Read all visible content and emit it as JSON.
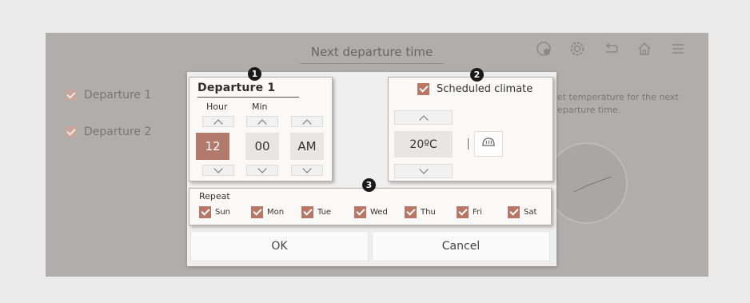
{
  "background": {
    "title": "Next departure time",
    "items": [
      {
        "label": "Departure 1",
        "checked": true
      },
      {
        "label": "Departure 2",
        "checked": true
      }
    ],
    "description": "Set temperature for the next departure time.",
    "icons": [
      "profile-icon",
      "gear-icon",
      "back-icon",
      "home-icon",
      "menu-icon"
    ]
  },
  "dialog": {
    "departure": {
      "title": "Departure 1",
      "hour_label": "Hour",
      "min_label": "Min",
      "hour": "12",
      "min": "00",
      "ampm": "AM"
    },
    "climate": {
      "scheduled_label": "Scheduled climate",
      "scheduled_checked": true,
      "temperature": "20ºC",
      "defrost_icon": "front-defrost-icon"
    },
    "repeat": {
      "label": "Repeat",
      "days": [
        {
          "label": "Sun",
          "checked": true
        },
        {
          "label": "Mon",
          "checked": true
        },
        {
          "label": "Tue",
          "checked": true
        },
        {
          "label": "Wed",
          "checked": true
        },
        {
          "label": "Thu",
          "checked": true
        },
        {
          "label": "Fri",
          "checked": true
        },
        {
          "label": "Sat",
          "checked": true
        }
      ]
    },
    "ok_label": "OK",
    "cancel_label": "Cancel"
  },
  "callouts": [
    "1",
    "2",
    "3"
  ],
  "colors": {
    "accent": "#b87665",
    "active_value": "#b27a6c",
    "overlay": "#b0aeac"
  }
}
